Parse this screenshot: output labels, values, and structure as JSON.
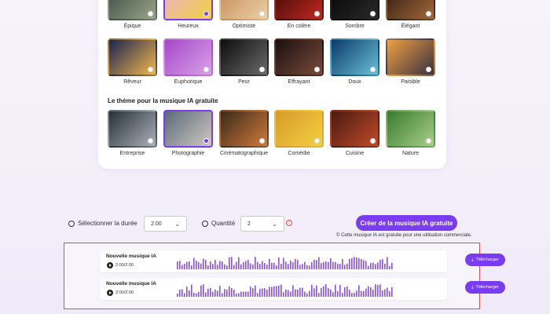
{
  "moods_row1": [
    {
      "label": "Épique",
      "colors": [
        "#3a4a40",
        "#9aa58a"
      ],
      "selected": false
    },
    {
      "label": "Heureux",
      "colors": [
        "#e8b0d0",
        "#f2d23a"
      ],
      "selected": true
    },
    {
      "label": "Optimiste",
      "colors": [
        "#c58a55",
        "#e9d1a8"
      ],
      "selected": false
    },
    {
      "label": "En colère",
      "colors": [
        "#3a0a0a",
        "#c3281d"
      ],
      "selected": false
    },
    {
      "label": "Sombre",
      "colors": [
        "#050505",
        "#2a2a2a"
      ],
      "selected": false
    },
    {
      "label": "Élégant",
      "colors": [
        "#2a1810",
        "#a56a3a"
      ],
      "selected": false
    }
  ],
  "moods_row2": [
    {
      "label": "Rêveur",
      "colors": [
        "#1b2450",
        "#f2b64a"
      ],
      "selected": false
    },
    {
      "label": "Euphorique",
      "colors": [
        "#a548c8",
        "#d9a0e8"
      ],
      "selected": false
    },
    {
      "label": "Peur",
      "colors": [
        "#0d0d0d",
        "#6a6a6a"
      ],
      "selected": false
    },
    {
      "label": "Effrayant",
      "colors": [
        "#1a1010",
        "#7a4a3a"
      ],
      "selected": false
    },
    {
      "label": "Doux",
      "colors": [
        "#0a3a6a",
        "#6ac0d8"
      ],
      "selected": false
    },
    {
      "label": "Paisible",
      "colors": [
        "#f0a040",
        "#3a3040"
      ],
      "selected": false
    }
  ],
  "theme_section_title": "Le thème pour la musique IA gratuite",
  "themes": [
    {
      "label": "Entreprise",
      "colors": [
        "#2a3038",
        "#a9b0b8"
      ],
      "selected": false
    },
    {
      "label": "Photographie",
      "colors": [
        "#5a6a78",
        "#d0c8c0"
      ],
      "selected": true
    },
    {
      "label": "Cinématographique",
      "colors": [
        "#3a2a1a",
        "#d07a3a"
      ],
      "selected": false
    },
    {
      "label": "Comédie",
      "colors": [
        "#d89a2a",
        "#f2d040"
      ],
      "selected": false
    },
    {
      "label": "Cuisine",
      "colors": [
        "#4a1a10",
        "#c04a2a"
      ],
      "selected": false
    },
    {
      "label": "Nature",
      "colors": [
        "#3a7a30",
        "#a8d088"
      ],
      "selected": false
    }
  ],
  "duration": {
    "label": "Sélectionner la durée",
    "value": "2:00"
  },
  "quantity": {
    "label": "Quantité",
    "value": "2"
  },
  "create_button": "Créer de la musique IA gratuite",
  "note": "Cette musique IA est gratuite pour une utilisation commerciale.",
  "tracks": [
    {
      "title": "Nouvelle musique IA",
      "time": "2:00/2:00",
      "download": "Télécharger"
    },
    {
      "title": "Nouvelle musique IA",
      "time": "2:00/2:00",
      "download": "Télécharger"
    }
  ],
  "colors": {
    "accent": "#7a3cf0",
    "highlight_border": "#e54b4b"
  }
}
